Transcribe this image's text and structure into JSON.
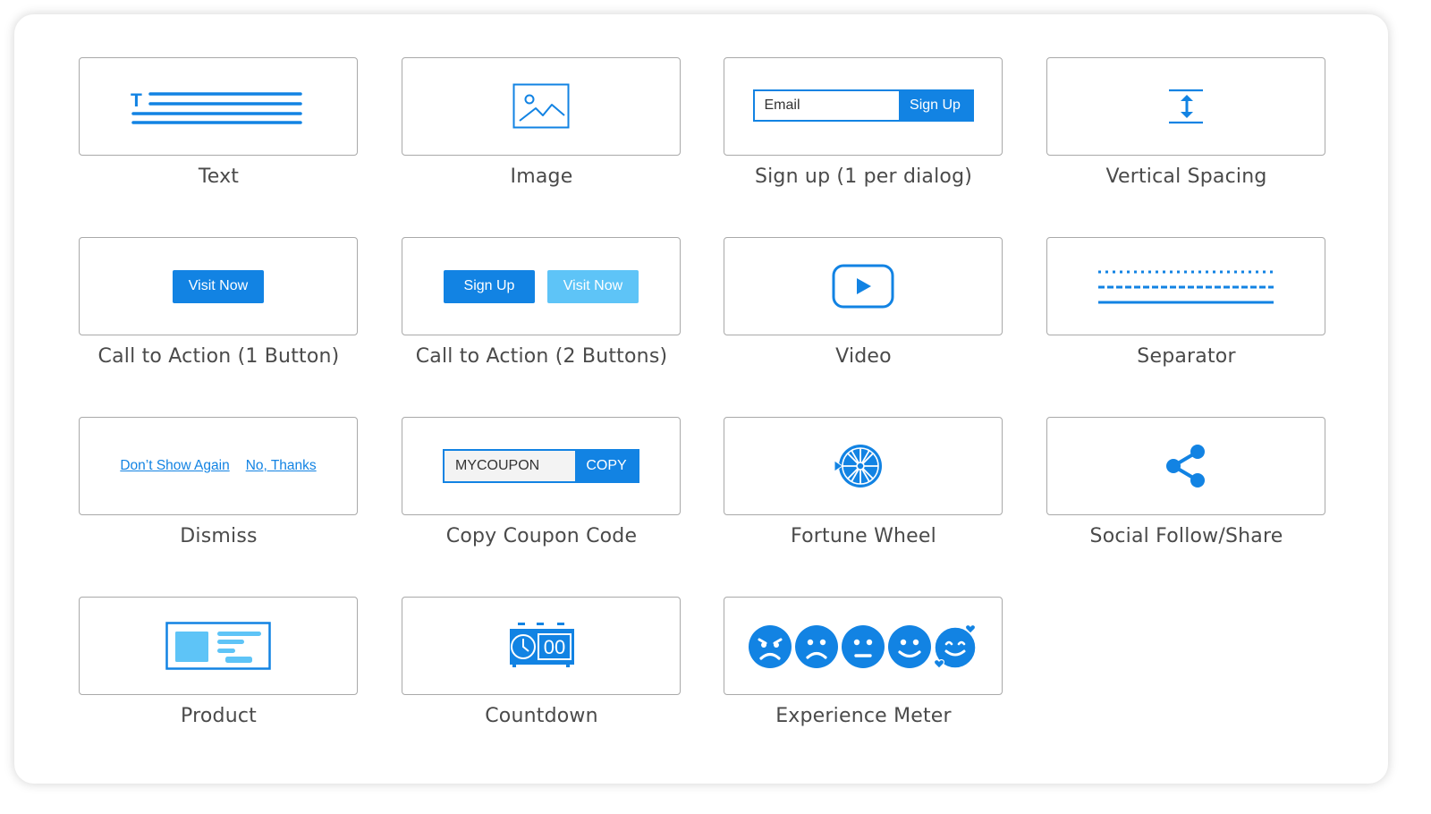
{
  "accent_color": "#1283e3",
  "accent_light_color": "#5ec4f7",
  "blocks": [
    {
      "label": "Text",
      "icon": "text-icon"
    },
    {
      "label": "Image",
      "icon": "image-icon"
    },
    {
      "label": "Sign up (1 per dialog)",
      "icon": "signup-form",
      "preview": {
        "email_placeholder": "Email",
        "button_label": "Sign Up"
      }
    },
    {
      "label": "Vertical Spacing",
      "icon": "vertical-spacing-icon"
    },
    {
      "label": "Call to Action (1 Button)",
      "icon": "cta-one-button",
      "preview": {
        "button_label": "Visit Now"
      }
    },
    {
      "label": "Call to Action (2 Buttons)",
      "icon": "cta-two-buttons",
      "preview": {
        "primary_label": "Sign Up",
        "secondary_label": "Visit Now"
      }
    },
    {
      "label": "Video",
      "icon": "video-play-icon"
    },
    {
      "label": "Separator",
      "icon": "separator-icon"
    },
    {
      "label": "Dismiss",
      "icon": "dismiss-links",
      "preview": {
        "link1": "Don’t Show Again",
        "link2": "No, Thanks"
      }
    },
    {
      "label": "Copy Coupon Code",
      "icon": "coupon-code",
      "preview": {
        "code": "MYCOUPON",
        "button_label": "COPY"
      }
    },
    {
      "label": "Fortune Wheel",
      "icon": "fortune-wheel-icon"
    },
    {
      "label": "Social Follow/Share",
      "icon": "share-icon"
    },
    {
      "label": "Product",
      "icon": "product-card-icon"
    },
    {
      "label": "Countdown",
      "icon": "countdown-timer-icon",
      "preview": {
        "digits": "00"
      }
    },
    {
      "label": "Experience Meter",
      "icon": "emoji-rating-icon"
    }
  ]
}
